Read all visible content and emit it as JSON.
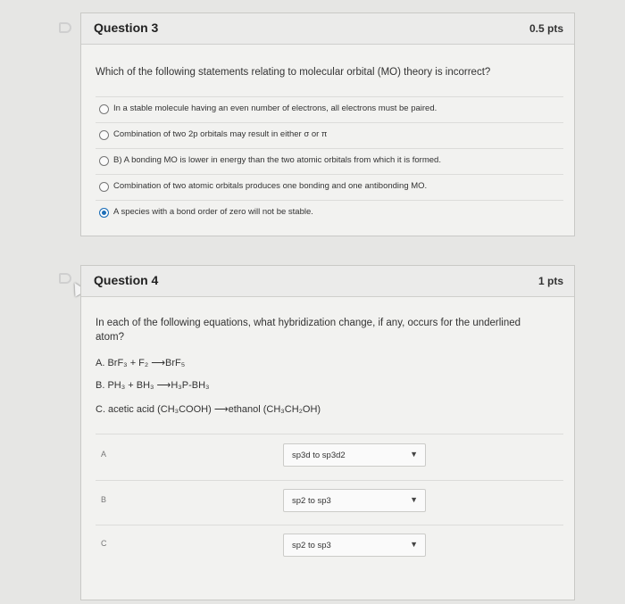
{
  "question3": {
    "title": "Question 3",
    "points": "0.5 pts",
    "prompt": "Which of the following statements relating to molecular orbital (MO) theory is incorrect?",
    "answers": [
      {
        "label": "In a stable molecule having an even number of electrons, all electrons must be paired.",
        "selected": false
      },
      {
        "label": "Combination of two 2p orbitals may result in either σ or π",
        "selected": false
      },
      {
        "label": "B) A bonding MO is lower in energy than the two atomic orbitals from which it is formed.",
        "selected": false
      },
      {
        "label": "Combination of two atomic orbitals produces one bonding and one antibonding MO.",
        "selected": false
      },
      {
        "label": "A species with a bond order of zero will not be stable.",
        "selected": true
      }
    ]
  },
  "question4": {
    "title": "Question 4",
    "points": "1 pts",
    "prompt": "In each of the following equations, what hybridization change, if any, occurs for the underlined atom?",
    "equations": [
      "A. BrF₃ + F₂ ⟶BrF₅",
      "B. PH₃ + BH₃ ⟶H₃P-BH₃",
      "C. acetic acid (CH₃COOH) ⟶ethanol (CH₃CH₂OH)"
    ],
    "matches": [
      {
        "label": "A",
        "value": "sp3d to sp3d2"
      },
      {
        "label": "B",
        "value": "sp2 to sp3"
      },
      {
        "label": "C",
        "value": "sp2 to sp3"
      }
    ]
  },
  "colors": {
    "selected_radio": "#1e6fb8"
  },
  "icons": {
    "flag": "flag-icon",
    "dropdown": "chevron-down-icon"
  }
}
